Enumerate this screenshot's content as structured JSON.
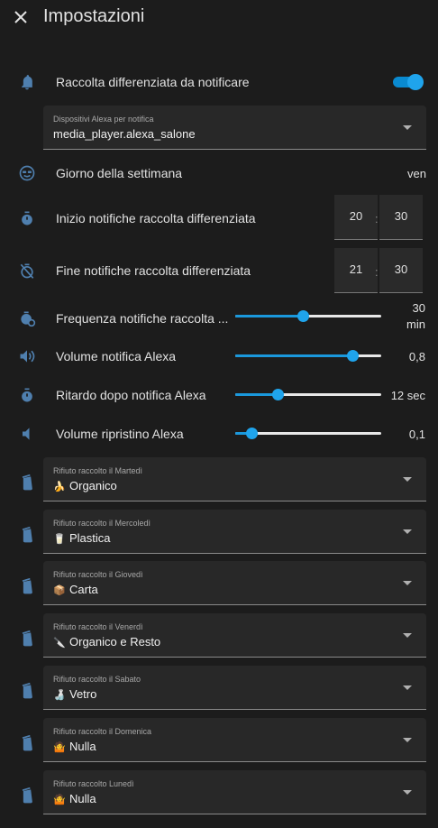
{
  "header": {
    "title": "Impostazioni"
  },
  "notify_toggle": {
    "label": "Raccolta differenziata da notificare",
    "on": true
  },
  "alexa_devices": {
    "label": "Dispositivi Alexa per notifica",
    "value": "media_player.alexa_salone"
  },
  "weekday": {
    "label": "Giorno della settimana",
    "value": "ven"
  },
  "start_time": {
    "label": "Inizio notifiche raccolta differenziata",
    "hour": "20",
    "minute": "30"
  },
  "end_time": {
    "label": "Fine notifiche raccolta differenziata",
    "hour": "21",
    "minute": "30"
  },
  "sliders": [
    {
      "label": "Frequenza notifiche raccolta ...",
      "value_line1": "30",
      "value_line2": "min",
      "fraction": 0.46
    },
    {
      "label": "Volume notifica Alexa",
      "value": "0,8",
      "fraction": 0.8
    },
    {
      "label": "Ritardo dopo notifica Alexa",
      "value": "12 sec",
      "fraction": 0.29
    },
    {
      "label": "Volume ripristino Alexa",
      "value": "0,1",
      "fraction": 0.11
    }
  ],
  "waste_days": [
    {
      "label": "Rifiuto raccolto il Martedì",
      "value": "Organico",
      "emoji": "🍌"
    },
    {
      "label": "Rifiuto raccolto il Mercoledì",
      "value": "Plastica",
      "emoji": "🥛"
    },
    {
      "label": "Rifiuto raccolto il Giovedì",
      "value": "Carta",
      "emoji": "📦"
    },
    {
      "label": "Rifiuto raccolto il Venerdì",
      "value": "Organico e Resto",
      "emoji": "🔪"
    },
    {
      "label": "Rifiuto raccolto il Sabato",
      "value": "Vetro",
      "emoji": "🍶"
    },
    {
      "label": "Rifiuto raccolto il Domenica",
      "value": "Nulla",
      "emoji": "🤷"
    },
    {
      "label": "Rifiuto raccolto Lunedì",
      "value": "Nulla",
      "emoji": "🤷"
    }
  ],
  "colors": {
    "accent": "#1fa4ec",
    "background": "#1c1c1c",
    "surface": "#282828",
    "icon": "#4f7fae"
  }
}
